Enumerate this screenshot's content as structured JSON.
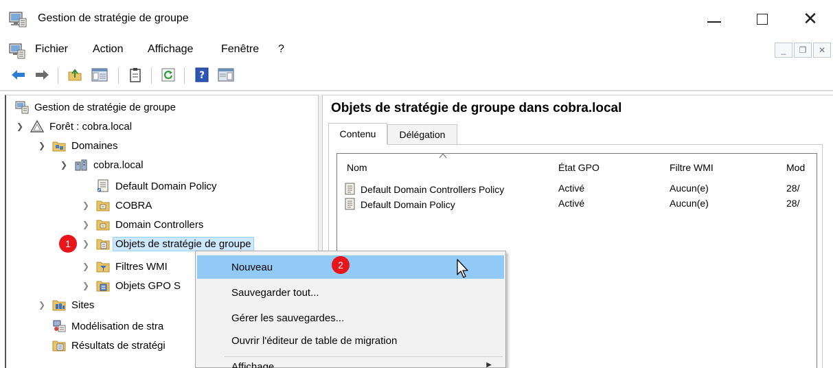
{
  "window": {
    "title": "Gestion de stratégie de groupe"
  },
  "menubar": {
    "items": [
      "Fichier",
      "Action",
      "Affichage",
      "Fenêtre",
      "?"
    ]
  },
  "toolbar": {
    "buttons": [
      "back-icon",
      "forward-icon",
      "up-folder-icon",
      "show-hide-tree-icon",
      "clipboard-icon",
      "refresh-icon",
      "help-icon",
      "action-pane-icon"
    ]
  },
  "tree": {
    "root": "Gestion de stratégie de groupe",
    "forest": "Forêt : cobra.local",
    "domains": "Domaines",
    "domain": "cobra.local",
    "default_policy": "Default Domain Policy",
    "cobra_ou": "COBRA",
    "dc_ou": "Domain Controllers",
    "gpo_objects": "Objets de stratégie de groupe",
    "wmi_filters": "Filtres WMI",
    "starter_gpo": "Objets GPO S",
    "sites": "Sites",
    "modeling": "Modélisation de stra",
    "results": "Résultats de stratégi"
  },
  "badges": {
    "one": "1",
    "two": "2"
  },
  "right": {
    "title": "Objets de stratégie de groupe dans cobra.local",
    "tabs": [
      "Contenu",
      "Délégation"
    ],
    "columns": [
      "Nom",
      "État GPO",
      "Filtre WMI",
      "Mod"
    ],
    "rows": [
      {
        "name": "Default Domain Controllers Policy",
        "state": "Activé",
        "wmi": "Aucun(e)",
        "mod": "28/"
      },
      {
        "name": "Default Domain Policy",
        "state": "Activé",
        "wmi": "Aucun(e)",
        "mod": "28/"
      }
    ]
  },
  "context_menu": {
    "items": [
      "Nouveau",
      "Sauvegarder tout...",
      "Gérer les sauvegardes...",
      "Ouvrir l'éditeur de table de migration",
      "Affichage"
    ]
  },
  "colors": {
    "selection": "#cce8ff",
    "menu_highlight": "#91c9f7",
    "badge": "#e8151a"
  }
}
